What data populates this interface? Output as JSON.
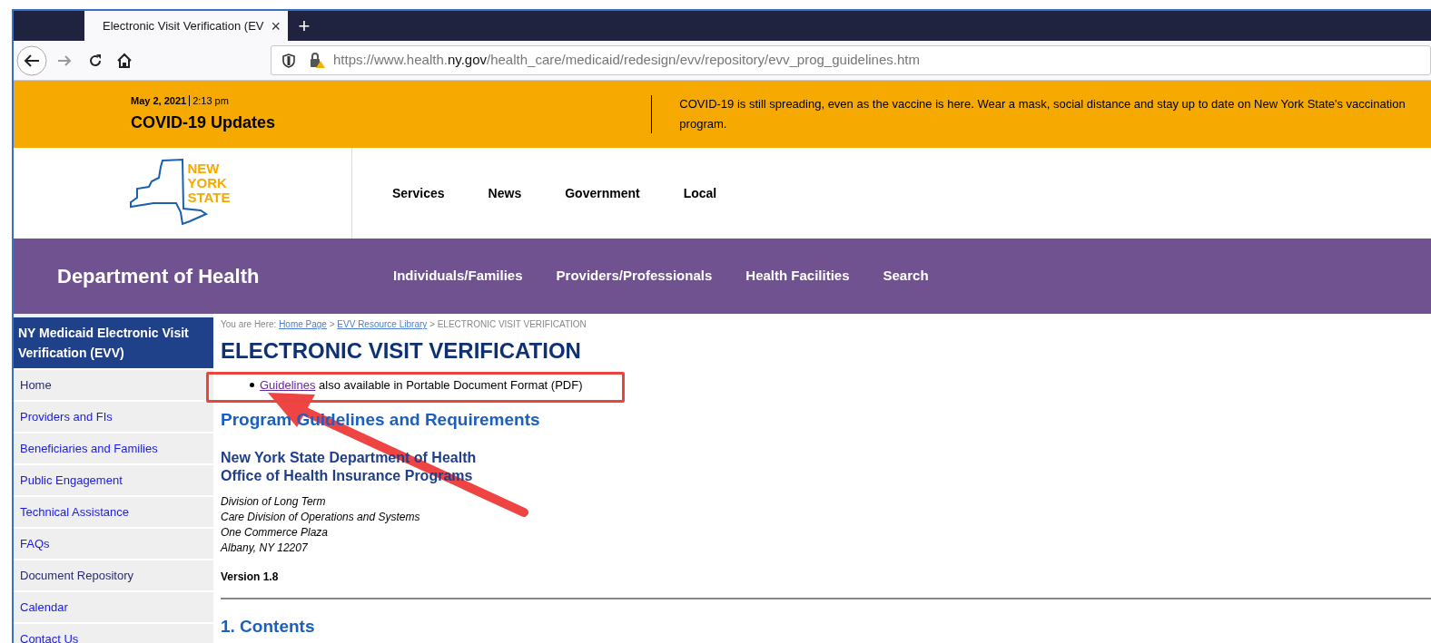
{
  "browser": {
    "tab_title": "Electronic Visit Verification (EV",
    "new_tab": "+",
    "close": "×",
    "url_prefix": "https://www.health.",
    "url_domain": "ny.gov",
    "url_path": "/health_care/medicaid/redesign/evv/repository/evv_prog_guidelines.htm"
  },
  "alert_banner": {
    "date": "May 2, 2021",
    "time": "2:13 pm",
    "title": "COVID-19 Updates",
    "message": "COVID-19 is still spreading, even as the vaccine is here. Wear a mask, social distance and stay up to date on New York State's vaccination program."
  },
  "state_header": {
    "logo_lines": [
      "NEW",
      "YORK",
      "STATE"
    ],
    "nav": [
      "Services",
      "News",
      "Government",
      "Local"
    ]
  },
  "agency_bar": {
    "title": "Department of Health",
    "nav": [
      "Individuals/Families",
      "Providers/Professionals",
      "Health Facilities",
      "Search"
    ]
  },
  "sidebar": {
    "heading": "NY Medicaid Electronic Visit Verification (EVV)",
    "items": [
      {
        "label": "Home",
        "visited": true
      },
      {
        "label": "Providers and FIs",
        "visited": false
      },
      {
        "label": "Beneficiaries and Families",
        "visited": false
      },
      {
        "label": "Public Engagement",
        "visited": false
      },
      {
        "label": "Technical Assistance",
        "visited": false
      },
      {
        "label": "FAQs",
        "visited": false
      },
      {
        "label": "Document Repository",
        "visited": true
      },
      {
        "label": "Calendar",
        "visited": false
      },
      {
        "label": "Contact Us",
        "visited": false
      }
    ]
  },
  "breadcrumb": {
    "prefix": "You are Here:",
    "links": [
      "Home Page",
      "EVV Resource Library"
    ],
    "separator": ">",
    "current": "ELECTRONIC VISIT VERIFICATION"
  },
  "page_title": "ELECTRONIC VISIT VERIFICATION",
  "pdf_note": {
    "link": "Guidelines",
    "text": "also available in Portable Document Format (PDF)"
  },
  "section_title": "Program Guidelines and Requirements",
  "org_lines": [
    "New York State Department of Health",
    "Office of Health Insurance Programs"
  ],
  "address_lines": [
    "Division of Long Term",
    "Care Division of Operations and Systems",
    "One Commerce Plaza",
    "Albany, NY 12207"
  ],
  "version": "Version 1.8",
  "contents_heading": "1. Contents"
}
